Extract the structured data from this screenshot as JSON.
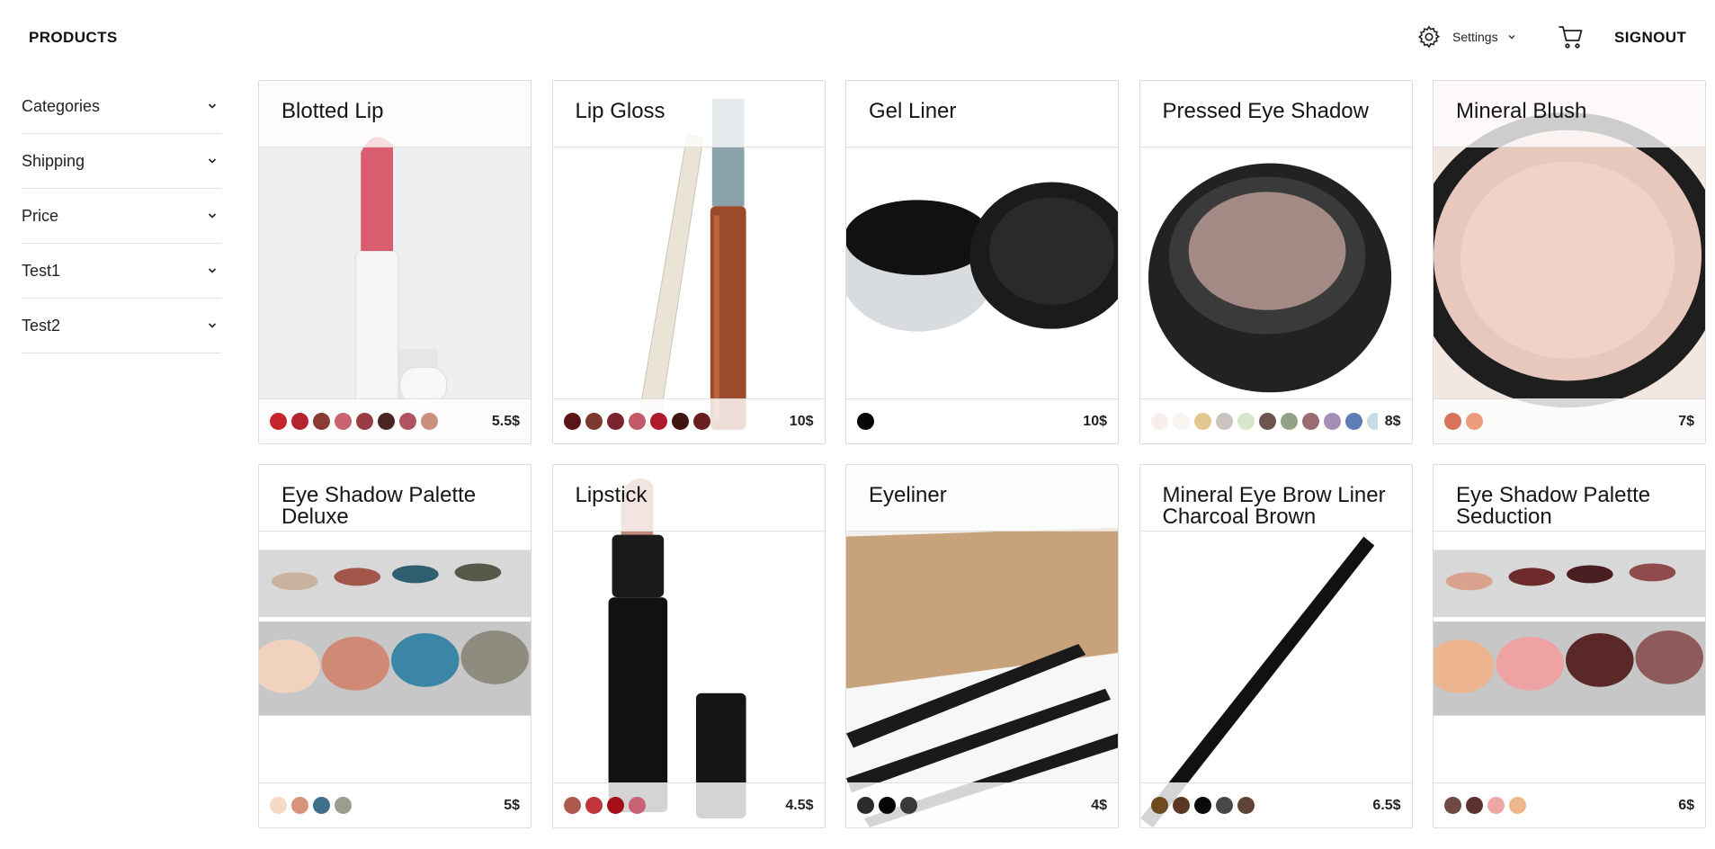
{
  "header": {
    "brand": "PRODUCTS",
    "settings_label": "Settings",
    "signout_label": "SIGNOUT"
  },
  "sidebar": {
    "filters": [
      {
        "label": "Categories"
      },
      {
        "label": "Shipping"
      },
      {
        "label": "Price"
      },
      {
        "label": "Test1"
      },
      {
        "label": "Test2"
      }
    ]
  },
  "products": [
    {
      "title": "Blotted Lip",
      "price": "5.5$",
      "image": "lipstick-pink",
      "swatches": [
        "#c8242b",
        "#b3242e",
        "#8b3b35",
        "#c76470",
        "#9a3c44",
        "#4a2420",
        "#b0525f",
        "#c9907d"
      ]
    },
    {
      "title": "Lip Gloss",
      "price": "10$",
      "image": "lip-gloss",
      "swatches": [
        "#5a1616",
        "#7c3a2e",
        "#7a2430",
        "#c25a6a",
        "#b0182c",
        "#3e1512",
        "#6a1e1e"
      ]
    },
    {
      "title": "Gel Liner",
      "price": "10$",
      "image": "gel-liner",
      "swatches": [
        "#050505"
      ]
    },
    {
      "title": "Pressed Eye Shadow",
      "price": "8$",
      "image": "pressed-shadow",
      "swatches": [
        "#f7efec",
        "#f9f4ee",
        "#e2c88e",
        "#cbc3bf",
        "#d8e6c9",
        "#6e5451",
        "#93a285",
        "#9a6c72",
        "#a68db5",
        "#5c7eb4",
        "#c6dce6",
        "#444240",
        "#e7d5d8"
      ]
    },
    {
      "title": "Mineral Blush",
      "price": "7$",
      "image": "mineral-blush",
      "swatches": [
        "#d7735a",
        "#eb9c7d"
      ]
    },
    {
      "title": "Eye Shadow Palette Deluxe",
      "price": "5$",
      "image": "palette-deluxe",
      "swatches": [
        "#f6d9c6",
        "#d8937b",
        "#3f6f8a",
        "#9d9d8b"
      ]
    },
    {
      "title": "Lipstick",
      "price": "4.5$",
      "image": "lipstick-black",
      "swatches": [
        "#b05a4e",
        "#c0343a",
        "#a50f18",
        "#c86173"
      ]
    },
    {
      "title": "Eyeliner",
      "price": "4$",
      "image": "eyeliner-pencils",
      "swatches": [
        "#2b2b2b",
        "#050505",
        "#3a3a3a"
      ]
    },
    {
      "title": "Mineral Eye Brow Liner Charcoal Brown",
      "price": "6.5$",
      "image": "brow-liner",
      "swatches": [
        "#6e4a1e",
        "#5a3824",
        "#0b0b0b",
        "#484848",
        "#5e4436"
      ]
    },
    {
      "title": "Eye Shadow Palette Seduction",
      "price": "6$",
      "image": "palette-seduction",
      "swatches": [
        "#6e4a42",
        "#5c3230",
        "#eea7a3",
        "#eeb68c"
      ]
    }
  ]
}
